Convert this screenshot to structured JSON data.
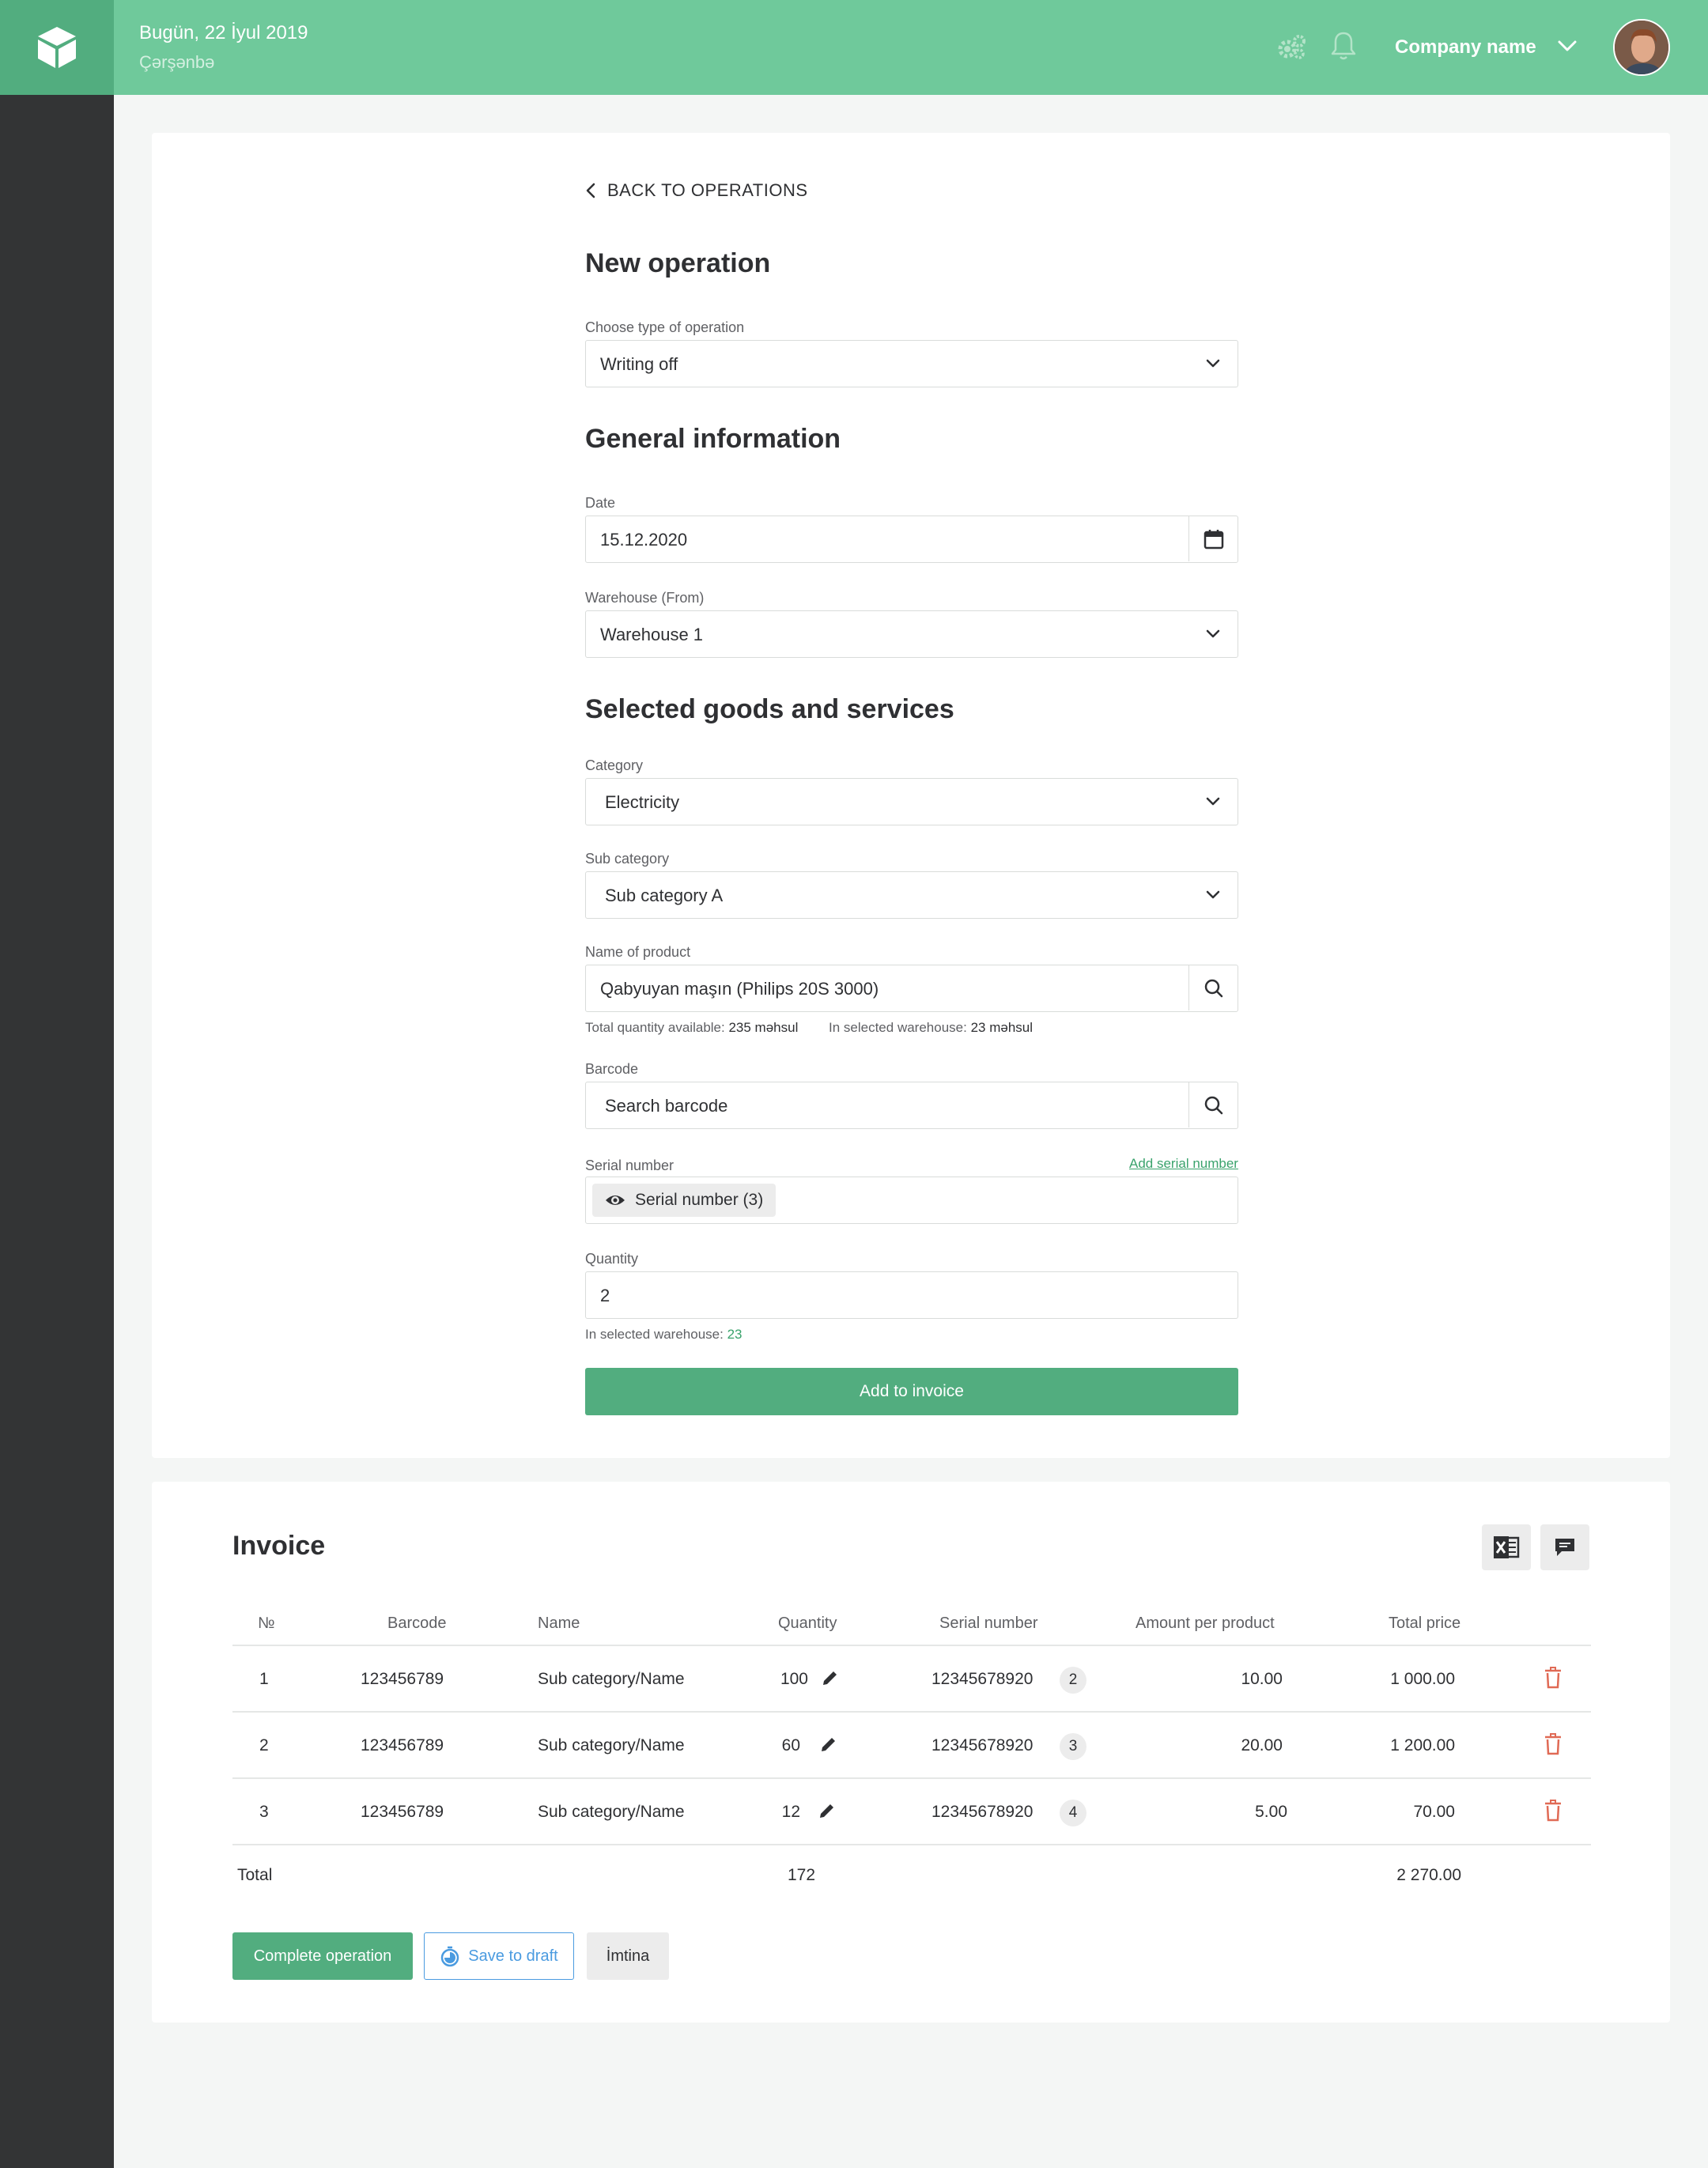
{
  "header": {
    "date": "Bugün, 22 İyul 2019",
    "day": "Çərşənbə",
    "company": "Company name",
    "icons": [
      "settings-gears-icon",
      "bell-icon",
      "chevron-down-icon"
    ]
  },
  "form": {
    "back_label": "BACK TO OPERATIONS",
    "title": "New operation",
    "operation_type": {
      "label": "Choose type of operation",
      "value": "Writing off"
    },
    "general_title": "General information",
    "date": {
      "label": "Date",
      "value": "15.12.2020"
    },
    "warehouse": {
      "label": "Warehouse (From)",
      "value": "Warehouse 1"
    },
    "goods_title": "Selected goods and services",
    "category": {
      "label": "Category",
      "value": "Electricity"
    },
    "subcategory": {
      "label": "Sub category",
      "value": "Sub category A"
    },
    "product": {
      "label": "Name of product",
      "value": "Qabyuyan maşın (Philips 20S 3000)",
      "total_prefix": "Total quantity available:",
      "total_value": "235 məhsul",
      "warehouse_prefix": "In selected warehouse:",
      "warehouse_value": "23 məhsul"
    },
    "barcode": {
      "label": "Barcode",
      "placeholder": "Search barcode"
    },
    "serial": {
      "label": "Serial number",
      "add_link": "Add serial number",
      "chip": "Serial number (3)"
    },
    "quantity": {
      "label": "Quantity",
      "value": "2",
      "hint_prefix": "In selected warehouse:",
      "hint_value": "23"
    },
    "add_button": "Add to invoice"
  },
  "invoice": {
    "title": "Invoice",
    "columns": [
      "№",
      "Barcode",
      "Name",
      "Quantity",
      "Serial number",
      "Amount per product",
      "Total price"
    ],
    "rows": [
      {
        "no": "1",
        "barcode": "123456789",
        "name": "Sub category/Name",
        "quantity": "100",
        "serial": "12345678920",
        "serial_count": "2",
        "amount": "10.00",
        "total": "1 000.00"
      },
      {
        "no": "2",
        "barcode": "123456789",
        "name": "Sub category/Name",
        "quantity": "60",
        "serial": "12345678920",
        "serial_count": "3",
        "amount": "20.00",
        "total": "1 200.00"
      },
      {
        "no": "3",
        "barcode": "123456789",
        "name": "Sub category/Name",
        "quantity": "12",
        "serial": "12345678920",
        "serial_count": "4",
        "amount": "5.00",
        "total": "70.00"
      }
    ],
    "total_label": "Total",
    "total_quantity": "172",
    "total_price": "2 270.00",
    "buttons": {
      "complete": "Complete operation",
      "draft": "Save to draft",
      "cancel": "İmtina"
    }
  },
  "colors": {
    "brand_green": "#52ad7f",
    "header_green": "#6fc99b",
    "sidebar": "#333435",
    "link_blue": "#4a9be0",
    "delete_red": "#e06a55"
  }
}
